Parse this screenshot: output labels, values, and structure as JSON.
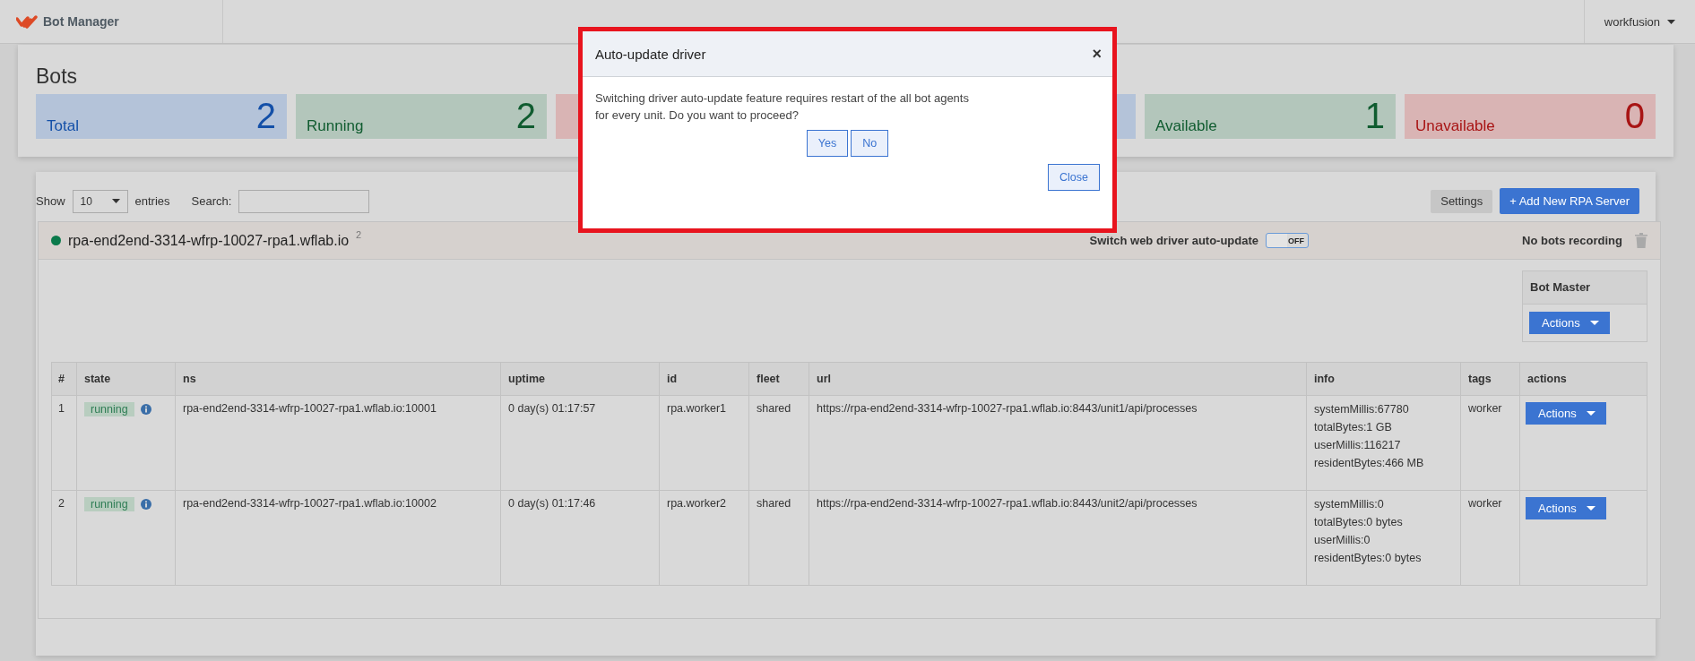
{
  "navbar": {
    "brand": "Bot Manager",
    "user_menu": "workfusion"
  },
  "bots_panel": {
    "title": "Bots",
    "cards": [
      {
        "label": "Total",
        "value": "2",
        "color": "#b4c3d9"
      },
      {
        "label": "Running",
        "value": "2",
        "color": "#b3c6bb"
      },
      {
        "color": "#d9b4b4"
      },
      {
        "color": "#b4c3d9"
      },
      {
        "label": "Available",
        "value": "1",
        "color": "#b3c6bb"
      },
      {
        "label": "Unavailable",
        "value": "0",
        "color": "#d9b4b4"
      }
    ]
  },
  "controls": {
    "show_label": "Show",
    "page_size": "10",
    "entries_label": "entries",
    "search_label": "Search:",
    "settings_button": "Settings",
    "add_button": "+ Add New RPA Server"
  },
  "server": {
    "name": "rpa-end2end-3314-wfrp-10027-rpa1.wflab.io",
    "online": true,
    "count": "2",
    "auto_update_label": "Switch web driver auto-update",
    "auto_update": {
      "on": false,
      "label": "OFF"
    },
    "recording": "No bots recording",
    "bot_master": {
      "title": "Bot Master",
      "button": "Actions"
    },
    "table": {
      "columns": [
        "#",
        "state",
        "ns",
        "uptime",
        "id",
        "fleet",
        "url",
        "info",
        "tags",
        "actions"
      ],
      "rows": [
        {
          "index": "1",
          "state": "running",
          "ns": "rpa-end2end-3314-wfrp-10027-rpa1.wflab.io:10001",
          "uptime": "0 day(s) 01:17:57",
          "id": "rpa.worker1",
          "fleet": "shared",
          "url": "https://rpa-end2end-3314-wfrp-10027-rpa1.wflab.io:8443/unit1/api/processes",
          "info": [
            "systemMillis:67780",
            "totalBytes:1 GB",
            "userMillis:116217",
            "residentBytes:466 MB"
          ],
          "tags": "worker",
          "action": "Actions"
        },
        {
          "index": "2",
          "state": "running",
          "ns": "rpa-end2end-3314-wfrp-10027-rpa1.wflab.io:10002",
          "uptime": "0 day(s) 01:17:46",
          "id": "rpa.worker2",
          "fleet": "shared",
          "url": "https://rpa-end2end-3314-wfrp-10027-rpa1.wflab.io:8443/unit2/api/processes",
          "info": [
            "systemMillis:0",
            "totalBytes:0 bytes",
            "userMillis:0",
            "residentBytes:0 bytes"
          ],
          "tags": "worker",
          "action": "Actions"
        }
      ]
    }
  },
  "modal": {
    "title": "Auto-update driver",
    "close": "×",
    "message": "Switching driver auto-update feature requires restart of the all bot agents for every unit. Do you want to proceed?",
    "buttons": [
      "Yes",
      "No"
    ],
    "footer_button": "Close"
  }
}
